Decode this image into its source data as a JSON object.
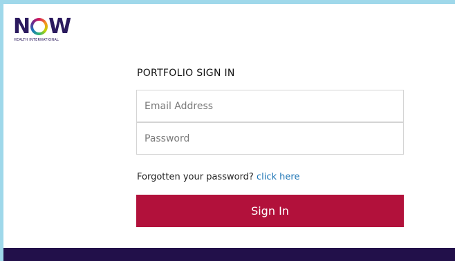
{
  "logo": {
    "word_start": "N",
    "word_end": "W",
    "subtitle": "HEALTH INTERNATIONAL"
  },
  "form": {
    "title": "PORTFOLIO SIGN IN",
    "email_placeholder": "Email Address",
    "email_value": "",
    "password_placeholder": "Password",
    "password_value": "",
    "forgot_text": "Forgotten your password?",
    "forgot_link": "click here",
    "submit_label": "Sign In"
  },
  "colors": {
    "frame": "#9fd8ea",
    "brand_primary": "#b2113b",
    "brand_dark": "#22104a",
    "link": "#1c74b5"
  }
}
